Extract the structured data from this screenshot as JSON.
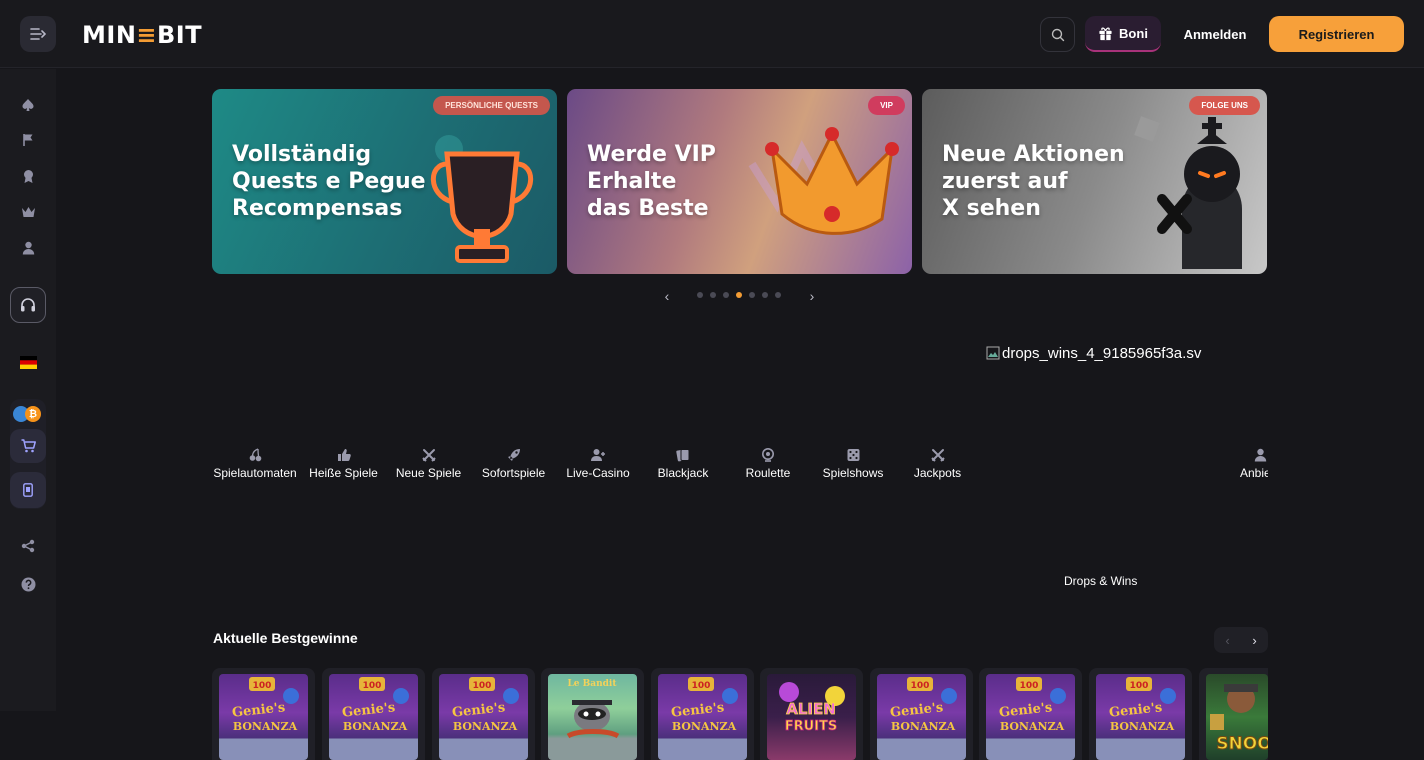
{
  "header": {
    "logo_pre": "MIN",
    "logo_e": "≡",
    "logo_post": "BIT",
    "boni_label": "Boni",
    "login_label": "Anmelden",
    "register_label": "Registrieren"
  },
  "sidebar": {
    "items": [
      "spade-icon",
      "flag-icon",
      "medal-icon",
      "crown-icon",
      "user-icon",
      "headset-icon",
      "flag-de-icon",
      "bitcoin-icon",
      "cart-icon",
      "phone-icon",
      "share-icon",
      "help-icon"
    ]
  },
  "banners": [
    {
      "badge": "PERSÖNLICHE QUESTS",
      "title": "Vollständig\nQuests e Pegue\nRecompensas"
    },
    {
      "badge": "VIP",
      "title": "Werde VIP\nErhalte\ndas Beste"
    },
    {
      "badge": "FOLGE UNS",
      "title": "Neue Aktionen\nzuerst auf\nX sehen"
    }
  ],
  "carousel": {
    "prev": "‹",
    "next": "›",
    "dot_count": 7,
    "active_dot": 4
  },
  "broken_image_alt": "drops_wins_4_9185965f3a.sv",
  "categories": [
    {
      "label": "Spielautomaten",
      "icon": "cherry-icon"
    },
    {
      "label": "Heiße Spiele",
      "icon": "thumbs-up-icon"
    },
    {
      "label": "Neue Spiele",
      "icon": "swords-icon"
    },
    {
      "label": "Sofortspiele",
      "icon": "rocket-icon"
    },
    {
      "label": "Live-Casino",
      "icon": "live-user-icon"
    },
    {
      "label": "Blackjack",
      "icon": "cards-icon"
    },
    {
      "label": "Roulette",
      "icon": "roulette-icon"
    },
    {
      "label": "Spielshows",
      "icon": "dice-icon"
    },
    {
      "label": "Jackpots",
      "icon": "swords-icon"
    },
    {
      "label": "Anbie",
      "icon": "person-icon"
    }
  ],
  "drops_label": "Drops & Wins",
  "winners": {
    "title": "Aktuelle Bestgewinne",
    "prev": "‹",
    "next": "›",
    "games": [
      "Genie's Bonanza",
      "Genie's Bonanza",
      "Genie's Bonanza",
      "Le Bandit",
      "Genie's Bonanza",
      "Alien Fruits",
      "Genie's Bonanza",
      "Genie's Bonanza",
      "Genie's Bonanza",
      "Snoop Dogg Dollars"
    ]
  },
  "colors": {
    "accent": "#f39c34",
    "register_bg": "#f7a03a",
    "boni_border": "#a8327a",
    "background": "#16161a"
  }
}
